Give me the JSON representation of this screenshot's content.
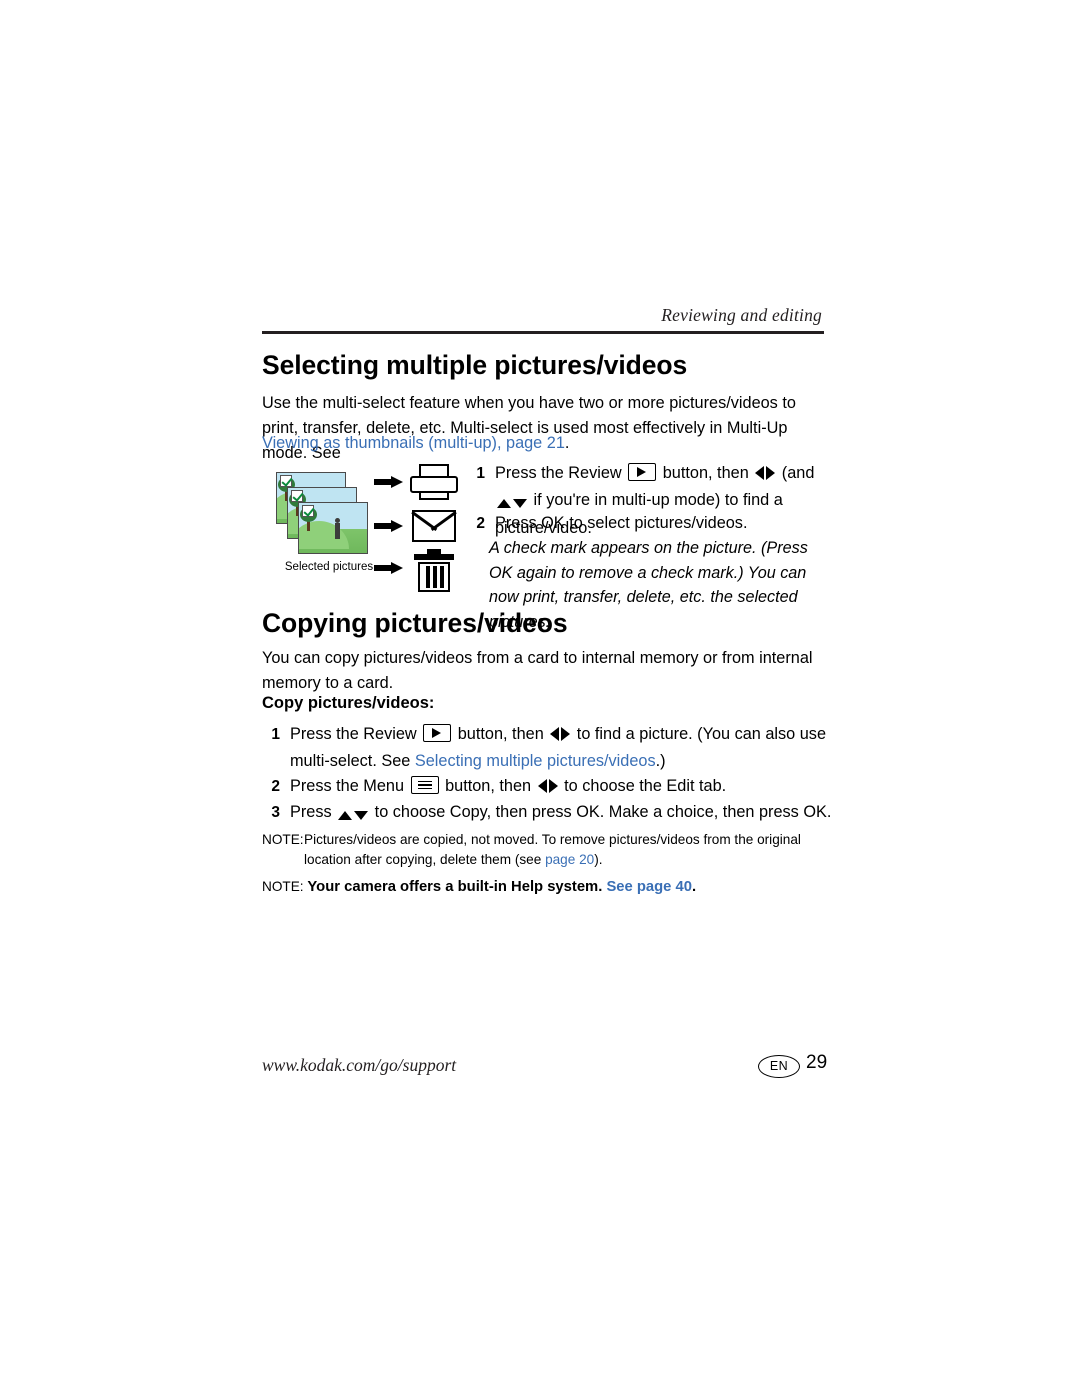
{
  "header": {
    "section_title": "Reviewing and editing"
  },
  "sections": [
    {
      "heading": "Selecting multiple pictures/videos",
      "intro": "Use the multi-select feature when you have two or more pictures/videos to print, transfer, delete, etc. Multi-select is used most effectively in Multi-Up mode. See ",
      "link_text": "Viewing as thumbnails (multi-up), page",
      "link_suffix": " 21",
      "link_period": ".",
      "steps": [
        {
          "num": "1",
          "text_before_btn": "Press the Review ",
          "button_icon": "review-play-button-icon",
          "text_after_btn": " button, then ",
          "arrows_lr": "left-right-arrows-icon",
          "text_mid": " (and ",
          "arrows_ud": "up-down-arrows-icon",
          "text_end": " if you're in multi-up mode) to find a picture/video."
        },
        {
          "num": "2",
          "text": "Press OK to select pictures/videos."
        }
      ],
      "italic_note": "A check mark appears on the picture. (Press OK again to remove a check mark.) You can now print, transfer, delete, etc. the selected pictures."
    },
    {
      "heading": "Copying pictures/videos",
      "intro": "You can copy pictures/videos from a card to internal memory or from internal memory to a card.",
      "subhead": "Copy pictures/videos:",
      "steps": [
        {
          "num": "1",
          "text_before_btn": "Press the Review ",
          "button_icon": "review-play-button-icon",
          "text_after_btn": " button, then ",
          "arrows_lr": "left-right-arrows-icon",
          "text_mid": " to find a picture. (You can also use multi-select. See ",
          "link_text": "Selecting multiple pictures/videos",
          "text_end": ".)"
        },
        {
          "num": "2",
          "text_before_btn": "Press the Menu ",
          "button_icon": "menu-button-icon",
          "text_after_btn": " button, then ",
          "arrows_lr": "left-right-arrows-icon",
          "text_end": " to choose the Edit tab."
        },
        {
          "num": "3",
          "text_before_btn": "Press ",
          "arrows_ud": "up-down-arrows-icon",
          "text_end": " to choose Copy, then press OK. Make a choice, then press OK."
        }
      ],
      "notes": [
        {
          "label": "NOTE:",
          "text": "Pictures/videos are copied, not moved. To remove pictures/videos from the original location after copying, delete them (see ",
          "link_text": "page 20",
          "text_end": ")."
        },
        {
          "label": "NOTE:",
          "text": "Your camera offers a built-in Help system. ",
          "link_text": "See page 40",
          "text_end": "."
        }
      ]
    }
  ],
  "illustration": {
    "label": "Selected pictures",
    "icons": [
      "photo-stack-icon",
      "arrow-right-icon",
      "printer-icon",
      "envelope-icon",
      "trash-can-icon"
    ]
  },
  "footer": {
    "url": "www.kodak.com/go/support",
    "language_badge": "EN",
    "page_number": "29"
  },
  "colors": {
    "link": "#3a6fb5",
    "text": "#000000",
    "rule": "#231f20"
  }
}
